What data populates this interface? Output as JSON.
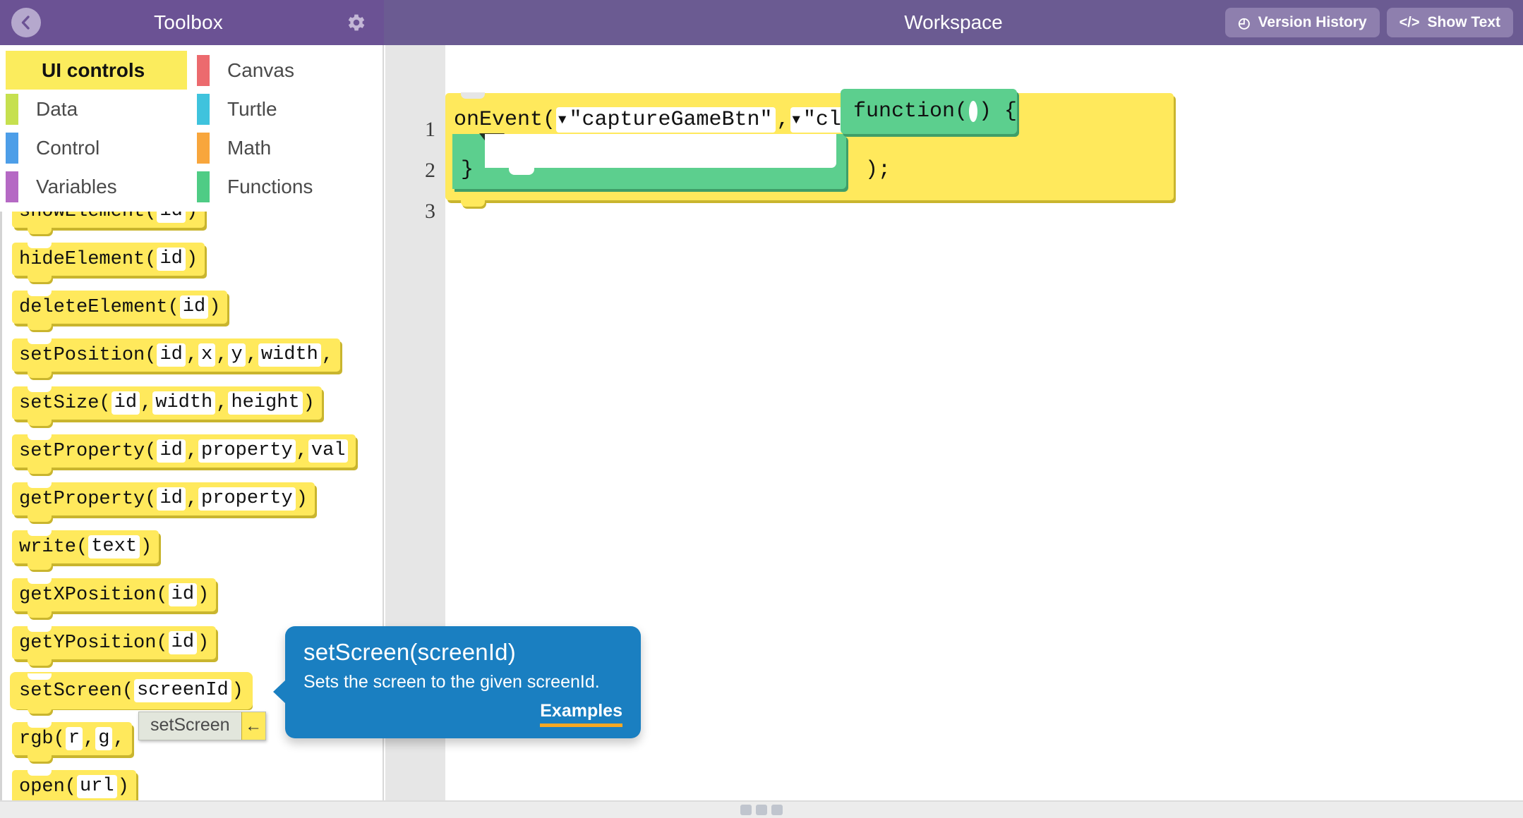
{
  "toolbox": {
    "title": "Toolbox",
    "back_icon": "back-chevron-icon",
    "settings_icon": "gear-icon",
    "categories": [
      {
        "label": "UI controls",
        "color": "#fbec5d",
        "selected": true
      },
      {
        "label": "Canvas",
        "color": "#ec6a6e",
        "selected": false
      },
      {
        "label": "Data",
        "color": "#c6e04f",
        "selected": false
      },
      {
        "label": "Turtle",
        "color": "#3fc3dd",
        "selected": false
      },
      {
        "label": "Control",
        "color": "#4d9ee8",
        "selected": false
      },
      {
        "label": "Math",
        "color": "#f8a63c",
        "selected": false
      },
      {
        "label": "Variables",
        "color": "#b569c4",
        "selected": false
      },
      {
        "label": "Functions",
        "color": "#4fcc85",
        "selected": false
      }
    ],
    "blocks": [
      {
        "name": "showElement",
        "parts": [
          {
            "t": "showElement("
          },
          {
            "s": "id"
          },
          {
            "t": ")"
          }
        ]
      },
      {
        "name": "hideElement",
        "parts": [
          {
            "t": "hideElement("
          },
          {
            "s": "id"
          },
          {
            "t": ")"
          }
        ]
      },
      {
        "name": "deleteElement",
        "parts": [
          {
            "t": "deleteElement("
          },
          {
            "s": "id"
          },
          {
            "t": ")"
          }
        ]
      },
      {
        "name": "setPosition",
        "parts": [
          {
            "t": "setPosition("
          },
          {
            "s": "id"
          },
          {
            "t": ", "
          },
          {
            "s": "x"
          },
          {
            "t": ", "
          },
          {
            "s": "y"
          },
          {
            "t": ", "
          },
          {
            "s": "width"
          },
          {
            "t": ","
          }
        ]
      },
      {
        "name": "setSize",
        "parts": [
          {
            "t": "setSize("
          },
          {
            "s": "id"
          },
          {
            "t": ", "
          },
          {
            "s": "width"
          },
          {
            "t": ", "
          },
          {
            "s": "height"
          },
          {
            "t": ")"
          }
        ]
      },
      {
        "name": "setProperty",
        "parts": [
          {
            "t": "setProperty("
          },
          {
            "s": "id"
          },
          {
            "t": ", "
          },
          {
            "s": "property"
          },
          {
            "t": ", "
          },
          {
            "s": "val"
          }
        ]
      },
      {
        "name": "getProperty",
        "parts": [
          {
            "t": "getProperty("
          },
          {
            "s": "id"
          },
          {
            "t": ", "
          },
          {
            "s": "property"
          },
          {
            "t": ")"
          }
        ]
      },
      {
        "name": "write",
        "parts": [
          {
            "t": "write("
          },
          {
            "s": "text"
          },
          {
            "t": ")"
          }
        ]
      },
      {
        "name": "getXPosition",
        "parts": [
          {
            "t": "getXPosition("
          },
          {
            "s": "id"
          },
          {
            "t": ")"
          }
        ]
      },
      {
        "name": "getYPosition",
        "parts": [
          {
            "t": "getYPosition("
          },
          {
            "s": "id"
          },
          {
            "t": ")"
          }
        ]
      },
      {
        "name": "setScreen",
        "parts": [
          {
            "t": "setScreen("
          },
          {
            "s": "screenId"
          },
          {
            "t": ")"
          }
        ],
        "selected": true
      },
      {
        "name": "rgb",
        "parts": [
          {
            "t": "rgb("
          },
          {
            "s": "r"
          },
          {
            "t": ", "
          },
          {
            "s": "g"
          },
          {
            "t": ","
          }
        ]
      },
      {
        "name": "open",
        "parts": [
          {
            "t": "open("
          },
          {
            "s": "url"
          },
          {
            "t": ")"
          }
        ]
      }
    ],
    "autocomplete": {
      "label": "setScreen",
      "key_glyph": "←"
    }
  },
  "tooltip": {
    "title": "setScreen(screenId)",
    "description": "Sets the screen to the given screenId.",
    "link": "Examples",
    "bg_color": "#1a7fc1",
    "underline_color": "#f7a823"
  },
  "workspace": {
    "title": "Workspace",
    "version_history": {
      "label": "Version History",
      "icon": "clock-icon",
      "glyph": "◴"
    },
    "show_text": {
      "label": "Show Text",
      "icon": "code-brackets-icon",
      "glyph": "</>"
    },
    "line_numbers": [
      "1",
      "2",
      "3"
    ],
    "code": {
      "fn_name": "onEvent(",
      "arg1": "\"captureGameBtn\"",
      "sep1": ", ",
      "arg2": "\"click\"",
      "sep2": ", ",
      "callback_open": "function(",
      "callback_close": ") {",
      "brace_close": "}",
      "tail": ");",
      "dropdown_glyph": "▼"
    }
  },
  "bottom_bar": {
    "handle": "drag-handle"
  },
  "colors": {
    "header_purple": "#6b5294",
    "workspace_purple": "#6b5b92",
    "block_yellow": "#ffe95c",
    "block_green": "#5ccf8e",
    "tooltip_blue": "#1a7fc1"
  }
}
